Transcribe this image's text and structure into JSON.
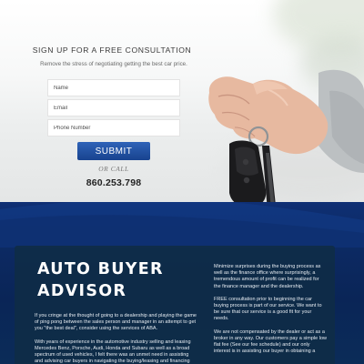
{
  "signup": {
    "title": "SIGN UP FOR A FREE CONSULTATION",
    "subtitle": "Remove the stress of negotiating getting the best car price.",
    "fields": {
      "name_placeholder": "Name",
      "email_placeholder": "Email",
      "phone_placeholder": "Phone Number"
    },
    "submit_label": "SUBMIT",
    "or_call": "OR CALL",
    "phone": "860.253.798"
  },
  "about": {
    "title_line1": "AUTO BUYER",
    "title_line2": "ADVISOR",
    "left_paragraphs": [
      "If you cringe at the thought of going to a dealership and playing the game of ping pong between the sales person and manager in an attempt to get you \"the best deal\", consider using the services of ABA.",
      "With years of experience in the automotive industry selling and leasing Mercedes Benz, Porsche, Audi, Honda and Subaru as well as a broad spectrum of used vehicles, I felt there was an unmet need in assisting and advising car buyers in navigating the buying/leasing and financing process."
    ],
    "right_paragraphs": [
      "Minimize surprises during the buying process as well as the finance office where surprisingly, a tremendous amount of profit can be realized for the finance manager and the dealership.",
      "FREE consultation prior to beginning the car buying process is part of our service. We want to be sure that our service is a good fit for your needs.",
      "We are not compensated by the dealer or act as a broker in any way. Our customers pay a simple low flat fee (See our fee schedule) and our only interest is in assisting our buyer in obtaining a"
    ]
  },
  "colors": {
    "submit": "#1f4f9e",
    "blue_section": "#0d2b66",
    "card": "#0f2c47"
  },
  "icons": {
    "hero": "hand-holding-car-key"
  }
}
